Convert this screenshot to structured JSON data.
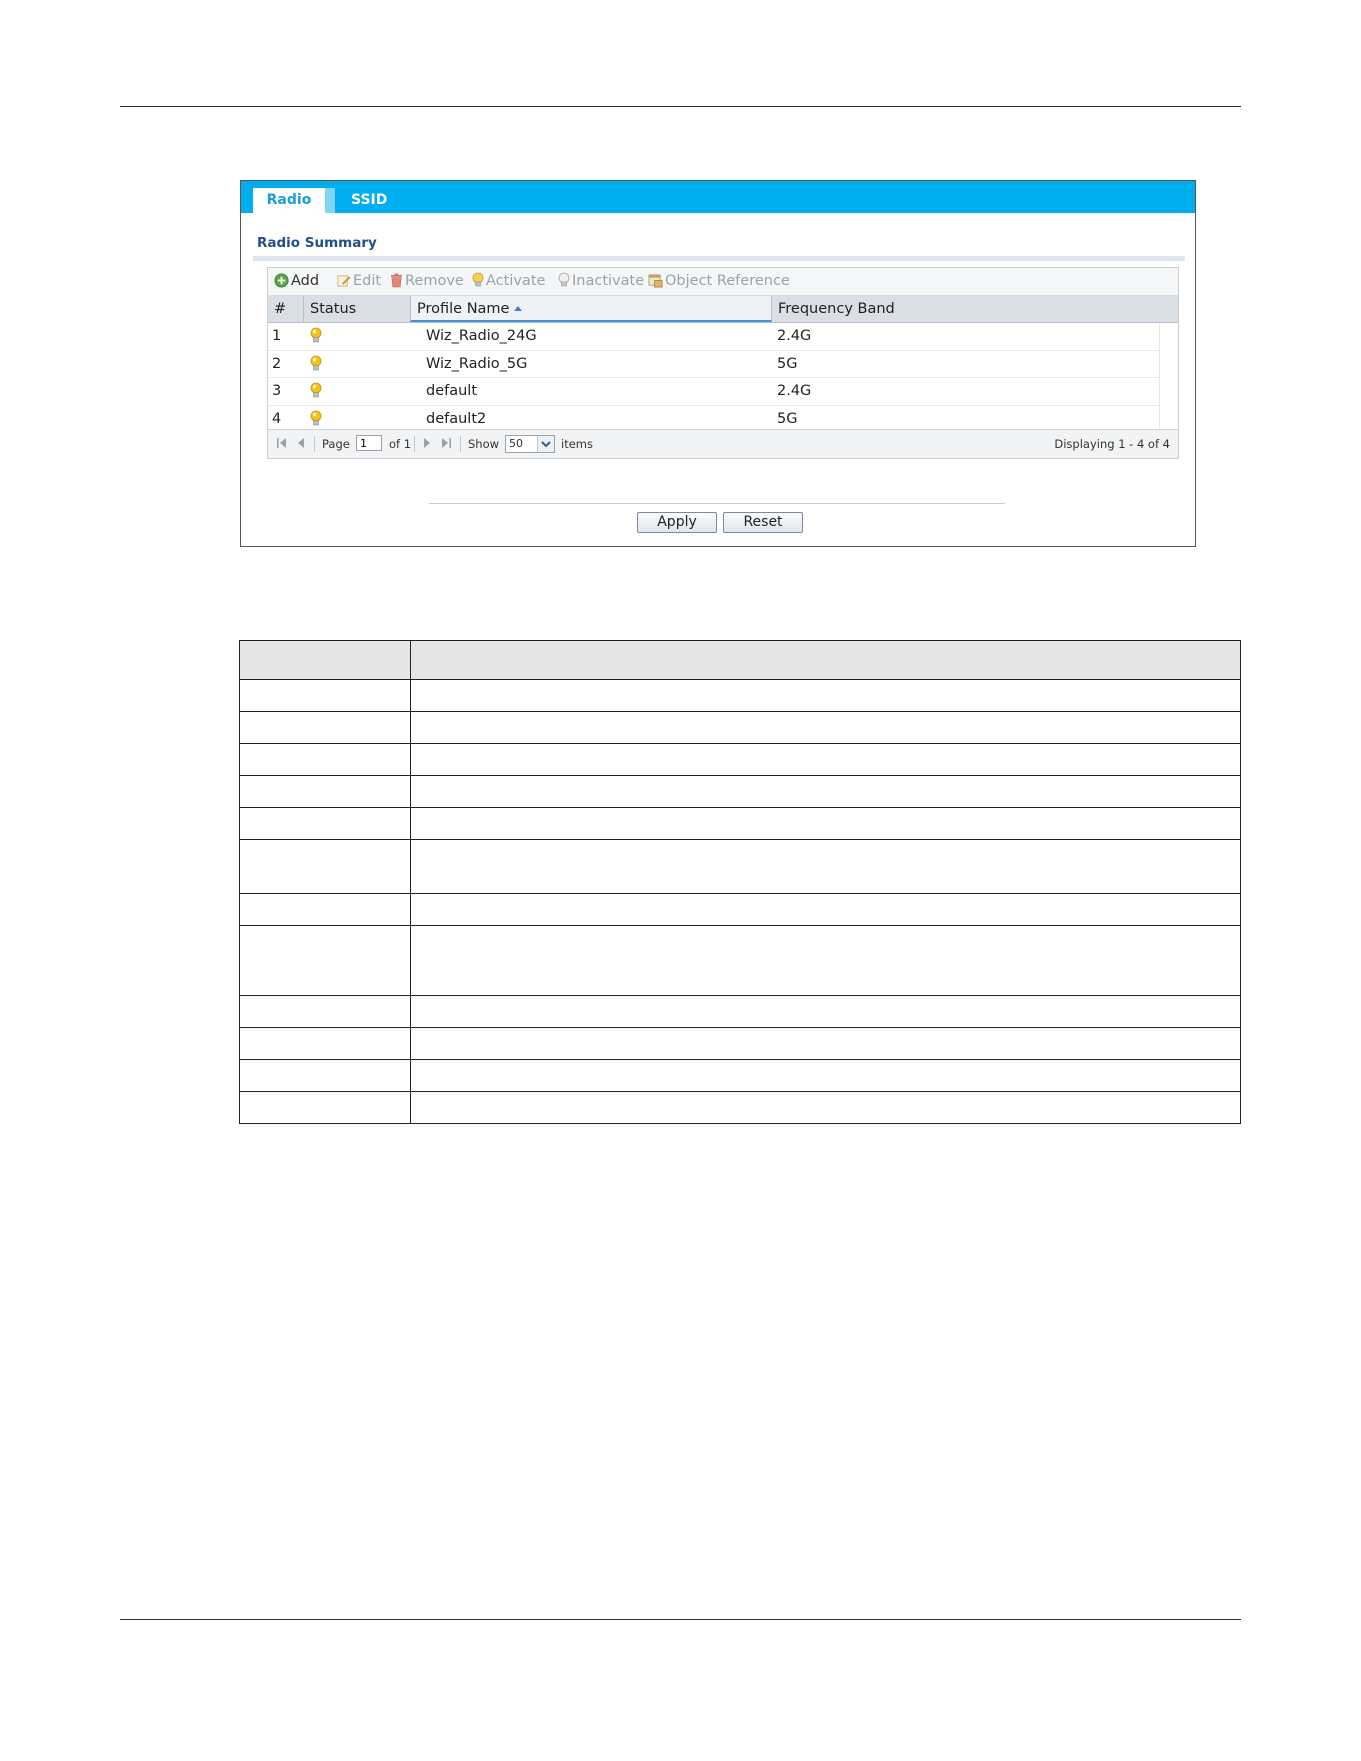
{
  "tabs": [
    {
      "label": "Radio",
      "active": true
    },
    {
      "label": "SSID",
      "active": false
    }
  ],
  "section_title": "Radio Summary",
  "toolbar": {
    "add": "Add",
    "edit": "Edit",
    "remove": "Remove",
    "activate": "Activate",
    "inactivate": "Inactivate",
    "object_reference": "Object Reference"
  },
  "columns": {
    "num": "#",
    "status": "Status",
    "profile_name": "Profile Name",
    "frequency_band": "Frequency Band"
  },
  "rows": [
    {
      "num": "1",
      "status": "active",
      "profile_name": "Wiz_Radio_24G",
      "frequency_band": "2.4G"
    },
    {
      "num": "2",
      "status": "active",
      "profile_name": "Wiz_Radio_5G",
      "frequency_band": "5G"
    },
    {
      "num": "3",
      "status": "active",
      "profile_name": "default",
      "frequency_band": "2.4G"
    },
    {
      "num": "4",
      "status": "active",
      "profile_name": "default2",
      "frequency_band": "5G"
    }
  ],
  "pager": {
    "page_label": "Page",
    "page_value": "1",
    "of_label": "of 1",
    "show_label": "Show",
    "show_value": "50",
    "items_label": "items",
    "displaying": "Displaying 1 - 4 of 4"
  },
  "buttons": {
    "apply": "Apply",
    "reset": "Reset"
  },
  "colors": {
    "tab_bar": "#00adef",
    "section_title": "#1f4f8f",
    "status_bulb": "#f2c21b"
  },
  "icons": {
    "add": "plus-circle-icon",
    "edit": "pencil-icon",
    "remove": "trash-icon",
    "activate": "lightbulb-on-icon",
    "inactivate": "lightbulb-off-icon",
    "object_reference": "object-reference-icon"
  }
}
